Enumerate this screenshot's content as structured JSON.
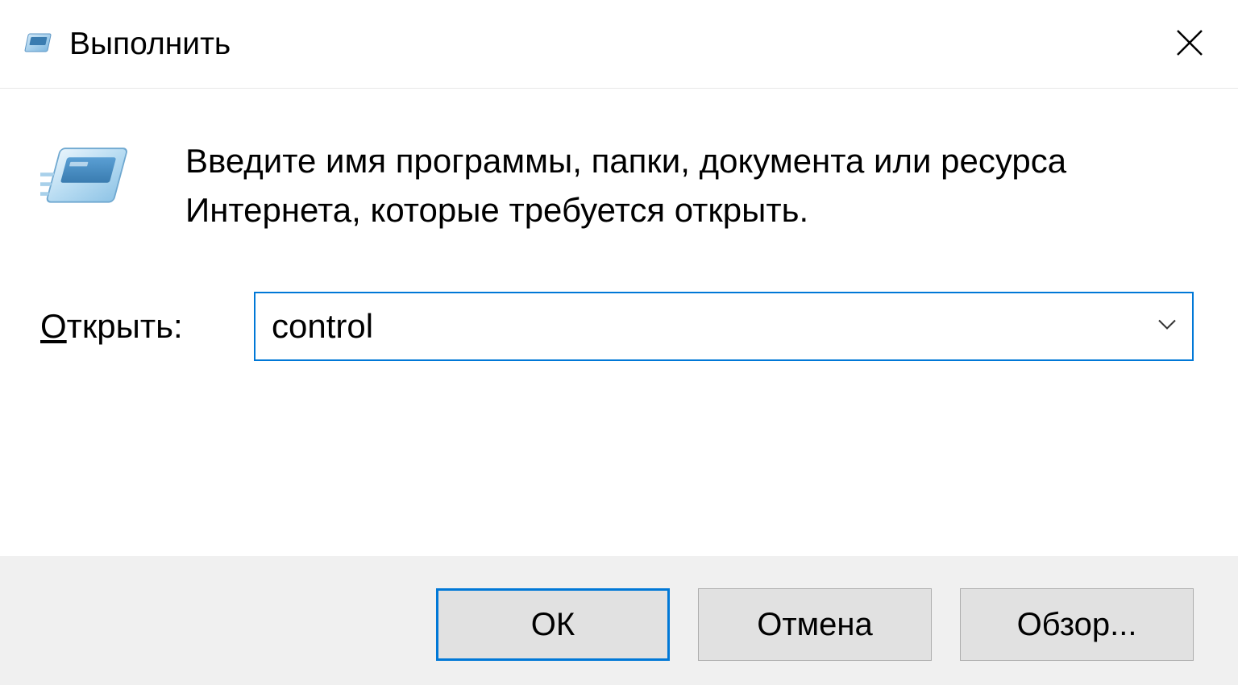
{
  "titlebar": {
    "title": "Выполнить"
  },
  "content": {
    "description": "Введите имя программы, папки, документа или ресурса Интернета, которые требуется открыть.",
    "input_label_underlined": "О",
    "input_label_rest": "ткрыть:",
    "input_value": "control"
  },
  "buttons": {
    "ok": "ОК",
    "cancel": "Отмена",
    "browse": "Обзор..."
  }
}
